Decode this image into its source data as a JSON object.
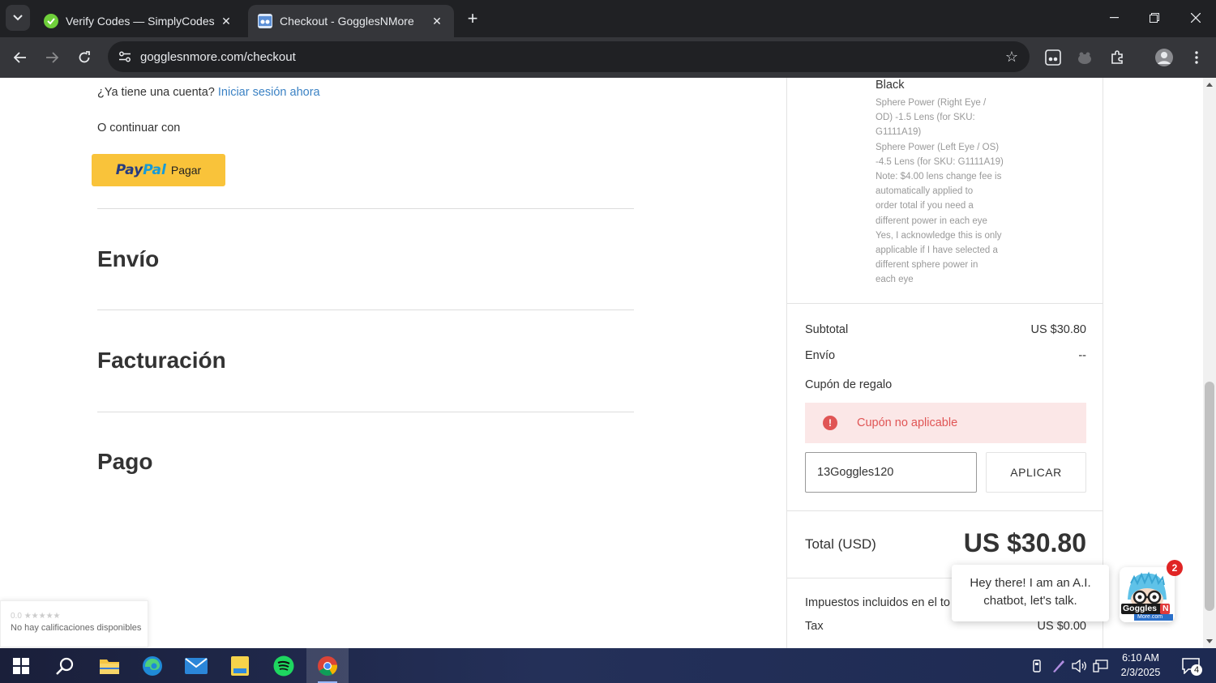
{
  "browser": {
    "tabs": [
      {
        "title": "Verify Codes — SimplyCodes",
        "active": false,
        "favicon_color": "#6fcf3a"
      },
      {
        "title": "Checkout - GogglesNMore",
        "active": true,
        "favicon_color": "#3b7dd8"
      }
    ],
    "url": "gogglesnmore.com/checkout"
  },
  "checkout": {
    "account_question": "¿Ya tiene una cuenta?",
    "login_link": "Iniciar sesión ahora",
    "continue_with": "O continuar con",
    "paypal": {
      "word_pay": "Pay",
      "word_pal": "Pal",
      "label": "Pagar"
    },
    "sections": [
      "Envío",
      "Facturación",
      "Pago"
    ]
  },
  "summary": {
    "product_color": "Black",
    "product_options": [
      "Sphere Power (Right Eye /",
      "OD) -1.5 Lens (for SKU:",
      "G1111A19)",
      "Sphere Power (Left Eye / OS)",
      "-4.5 Lens (for SKU: G1111A19)",
      "Note: $4.00 lens change fee is",
      "automatically applied to",
      "order total if you need a",
      "different power in each eye",
      "Yes, I acknowledge this is only",
      "applicable if I have selected a",
      "different sphere power in",
      "each eye"
    ],
    "subtotal_label": "Subtotal",
    "subtotal_value": "US $30.80",
    "shipping_label": "Envío",
    "shipping_value": "--",
    "coupon_label": "Cupón de regalo",
    "coupon_error": "Cupón no aplicable",
    "coupon_value": "13Goggles120",
    "apply_label": "APLICAR",
    "total_label": "Total (USD)",
    "total_value": "US $30.80",
    "tax_note": "Impuestos incluidos en el to",
    "tax_label": "Tax",
    "tax_value": "US $0.00"
  },
  "chat": {
    "message_line1": "Hey there! I am an A.I.",
    "message_line2": "chatbot, let's talk.",
    "badge_count": "2",
    "bot_brand_top": "Goggles",
    "bot_brand_n": "N",
    "bot_brand_bottom": "More.com"
  },
  "ratings_widget": {
    "score": "0.0",
    "stars": "★★★★★",
    "text": "No hay calificaciones disponibles"
  },
  "taskbar": {
    "time": "6:10 AM",
    "date": "2/3/2025",
    "notifications": "4"
  }
}
